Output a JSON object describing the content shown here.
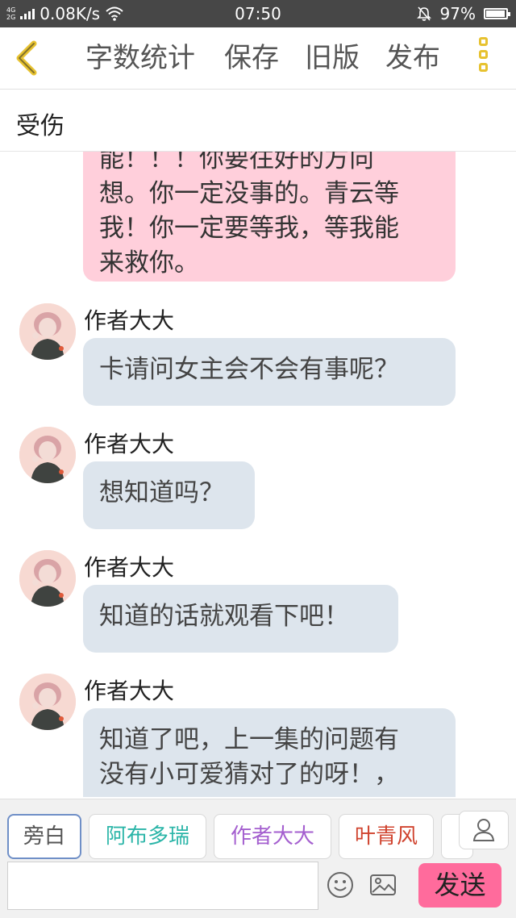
{
  "status_bar": {
    "network_type": "4G 2G",
    "speed": "0.08K/s",
    "time": "07:50",
    "battery_percent": "97%",
    "battery_level": 0.97
  },
  "toolbar": {
    "word_count_label": "字数统计",
    "save_label": "保存",
    "old_version_label": "旧版",
    "publish_label": "发布"
  },
  "title": "受伤",
  "top_message": {
    "lines": [
      "能！！！你要往好的方向",
      "想。你一定没事的。青云等",
      "我！你一定要等我，等我能",
      "来救你。"
    ]
  },
  "messages": [
    {
      "author": "作者大大",
      "lines": [
        "卡请问女主会不会有事呢？"
      ]
    },
    {
      "author": "作者大大",
      "lines": [
        "想知道吗？"
      ]
    },
    {
      "author": "作者大大",
      "lines": [
        "知道的话就观看下吧！"
      ]
    },
    {
      "author": "作者大大",
      "lines": [
        "知道了吧，上一集的问题有",
        "没有小可爱猜对了的呀！，"
      ]
    }
  ],
  "characters": [
    {
      "label": "旁白",
      "color": "#555555",
      "selected": true
    },
    {
      "label": "阿布多瑞",
      "color": "#2bb5a8",
      "selected": false
    },
    {
      "label": "作者大大",
      "color": "#a45fcf",
      "selected": false
    },
    {
      "label": "叶青风",
      "color": "#d0432e",
      "selected": false
    }
  ],
  "input": {
    "value": "",
    "placeholder": ""
  },
  "send_label": "发送",
  "colors": {
    "accent_yellow": "#e7c230",
    "send_pink": "#ff6b9c",
    "bubble_pink": "#ffcfdb",
    "bubble_gray": "#dde5ed"
  }
}
